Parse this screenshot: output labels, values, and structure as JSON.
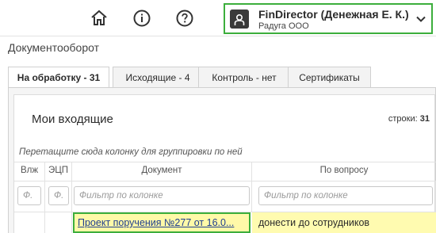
{
  "topbar": {
    "icons": [
      "home-icon",
      "info-icon",
      "help-icon"
    ],
    "user": {
      "name": "FinDirector (Денежная Е. К.)",
      "company": "Радуга ООО"
    }
  },
  "section_title": "Документооборот",
  "tabs": [
    {
      "label": "На обработку - 31",
      "active": true
    },
    {
      "label": "Исходящие - 4",
      "active": false
    },
    {
      "label": "Контроль - нет",
      "active": false
    },
    {
      "label": "Сертификаты",
      "active": false
    }
  ],
  "grid": {
    "title": "Мои входящие",
    "rows_label": "строки:",
    "rows_count": "31",
    "group_hint": "Перетащите сюда колонку для группировки по ней",
    "columns": [
      "Влж",
      "ЭЦП",
      "Документ",
      "По вопросу"
    ],
    "filters": [
      "Ф.",
      "Ф.",
      "Фильтр по колонке",
      "Фильтр по колонке"
    ],
    "rows": [
      {
        "document": "Проект поручения №277 от 16.0...",
        "question": "донести до сотрудников"
      }
    ]
  },
  "colors": {
    "highlight_border": "#3cae3c",
    "row_highlight": "#fffbb0",
    "link": "#1f3f8f"
  }
}
